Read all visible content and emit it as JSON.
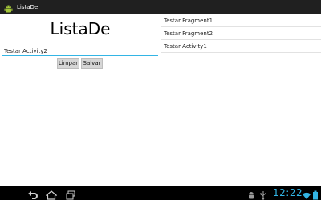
{
  "action_bar": {
    "title": "ListaDe",
    "icon": "android-icon"
  },
  "main": {
    "heading": "ListaDe",
    "input_value": "Testar Activity2",
    "buttons": {
      "clear_label": "Limpar",
      "save_label": "Salvar"
    }
  },
  "list": {
    "items": [
      {
        "label": "Testar Fragment1"
      },
      {
        "label": "Testar Fragment2"
      },
      {
        "label": "Testar Activity1"
      }
    ]
  },
  "system_bar": {
    "clock": "12:22",
    "accent_color": "#33b5e5",
    "icons": [
      "back-icon",
      "home-icon",
      "recent-apps-icon",
      "debug-icon",
      "usb-icon",
      "wifi-icon",
      "battery-icon"
    ]
  }
}
